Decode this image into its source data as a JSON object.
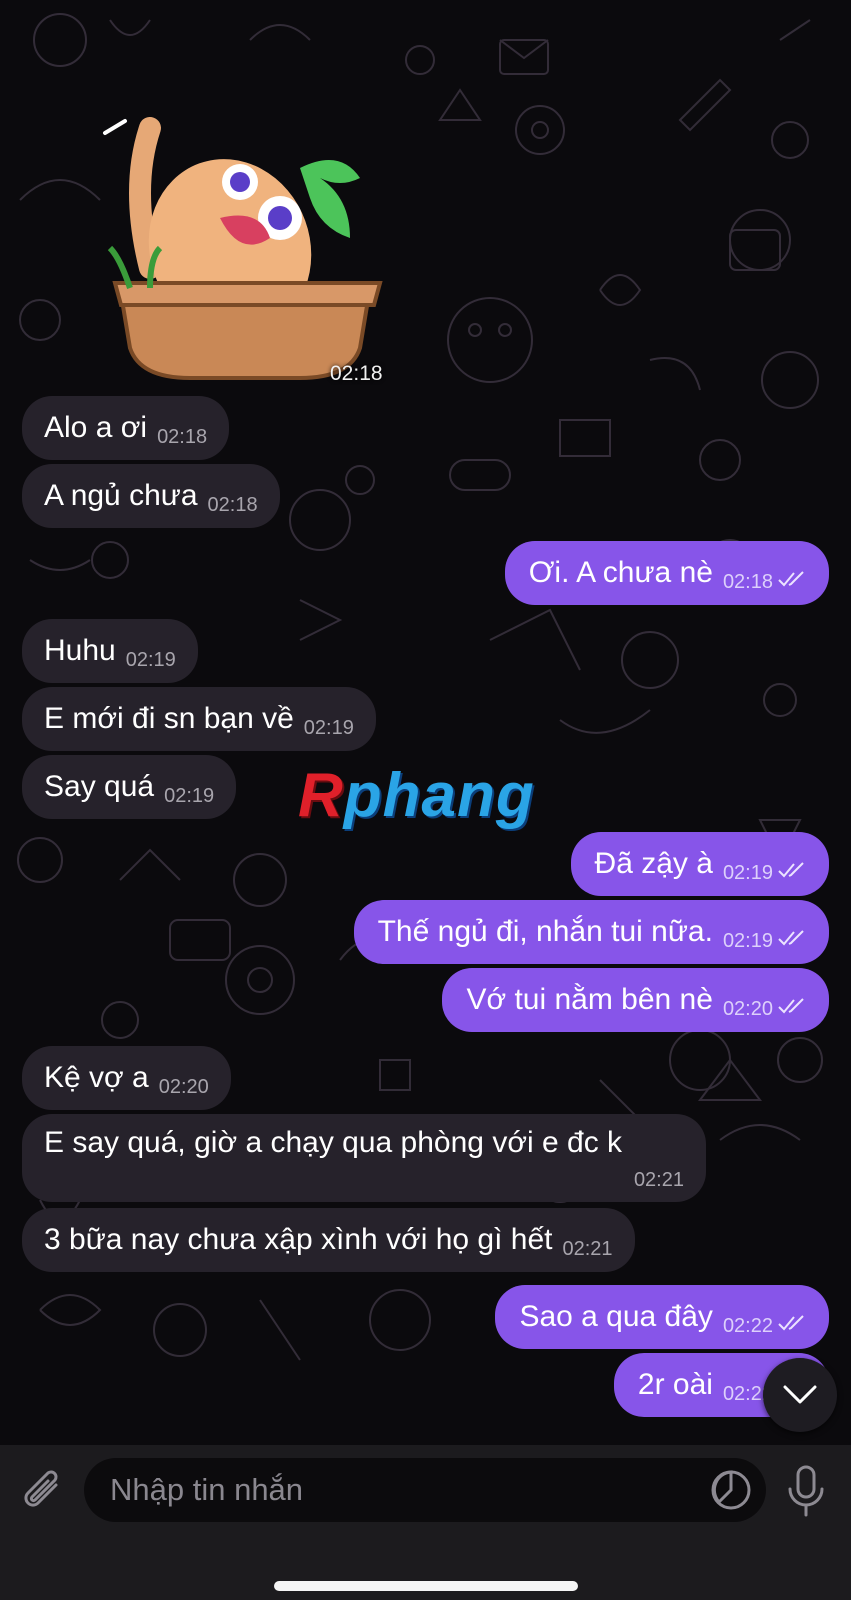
{
  "colors": {
    "background": "#0b0a0d",
    "incoming_bubble": "#26222b",
    "outgoing_bubble": "#8755e9",
    "input_bar": "#1c1b1e"
  },
  "sticker": {
    "icon": "potato-in-tub-sticker",
    "time": "02:18"
  },
  "messages": [
    {
      "side": "in",
      "text": "Alo a ơi",
      "time": "02:18"
    },
    {
      "side": "in",
      "text": "A ngủ chưa",
      "time": "02:18"
    },
    {
      "side": "out",
      "text": "Ơi. A chưa nè",
      "time": "02:18",
      "status": "read"
    },
    {
      "side": "in",
      "text": "Huhu",
      "time": "02:19"
    },
    {
      "side": "in",
      "text": "E mới đi sn bạn về",
      "time": "02:19"
    },
    {
      "side": "in",
      "text": "Say quá",
      "time": "02:19"
    },
    {
      "side": "out",
      "text": "Đã zậy à",
      "time": "02:19",
      "status": "read"
    },
    {
      "side": "out",
      "text": "Thế ngủ đi, nhắn tui nữa.",
      "time": "02:19",
      "status": "read"
    },
    {
      "side": "out",
      "text": "Vớ tui nằm bên nè",
      "time": "02:20",
      "status": "read"
    },
    {
      "side": "in",
      "text": "Kệ vợ a",
      "time": "02:20"
    },
    {
      "side": "in",
      "text": "E say quá, giờ a chạy qua phòng với e đc k",
      "time": "02:21"
    },
    {
      "side": "in",
      "text": "3 bữa nay chưa xập xình với họ gì hết",
      "time": "02:21"
    },
    {
      "side": "out",
      "text": "Sao a qua đây",
      "time": "02:22",
      "status": "read"
    },
    {
      "side": "out",
      "text": "2r oài",
      "time": "02:22",
      "status": "read"
    }
  ],
  "watermark": {
    "first": "R",
    "rest": "phang"
  },
  "input": {
    "placeholder": "Nhập tin nhắn"
  },
  "icons": {
    "attach": "paperclip-icon",
    "sticker": "sticker-icon",
    "mic": "microphone-icon",
    "scroll": "chevron-down-icon"
  }
}
